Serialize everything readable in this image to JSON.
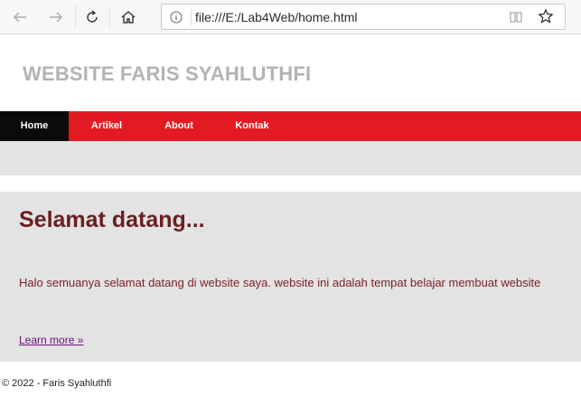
{
  "browser": {
    "url": "file:///E:/Lab4Web/home.html",
    "icons": [
      "back-icon",
      "forward-icon",
      "refresh-icon",
      "home-icon",
      "info-icon",
      "reading-view-icon",
      "favorite-star-icon"
    ]
  },
  "site": {
    "title": "WEBSITE FARIS SYAHLUTHFI"
  },
  "nav": {
    "items": [
      {
        "label": "Home",
        "active": true
      },
      {
        "label": "Artikel",
        "active": false
      },
      {
        "label": "About",
        "active": false
      },
      {
        "label": "Kontak",
        "active": false
      }
    ]
  },
  "main": {
    "heading": "Selamat datang...",
    "paragraph": "Halo semuanya selamat datang di website saya. website ini adalah tempat belajar membuat website",
    "link": "Learn more »"
  },
  "footer": {
    "text": "© 2022 - Faris Syahluthfi"
  },
  "colors": {
    "nav_bg": "#e21b23",
    "nav_active": "#0b0b0b",
    "panel_bg": "#e3e3e3",
    "heading": "#6a1f1f",
    "title": "#b3b3b3"
  }
}
